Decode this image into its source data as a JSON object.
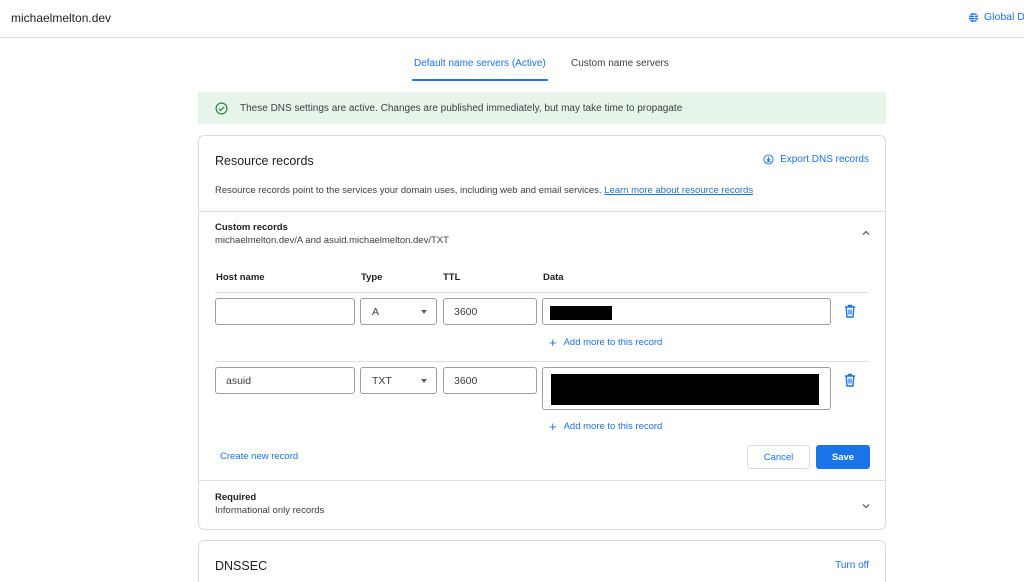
{
  "header": {
    "site_name": "michaelmelton.dev",
    "global_label": "Global D"
  },
  "tabs": [
    {
      "label": "Default name servers (Active)",
      "active": true
    },
    {
      "label": "Custom name servers",
      "active": false
    }
  ],
  "banner": {
    "text": "These DNS settings are active. Changes are published immediately, but may take time to propagate"
  },
  "resource_records": {
    "title": "Resource records",
    "export_label": "Export DNS records",
    "description": "Resource records point to the services your domain uses, including web and email services.",
    "learn_more": "Learn more about resource records",
    "custom": {
      "title": "Custom records",
      "subtitle": "michaelmelton.dev/A and asuid.michaelmelton.dev/TXT",
      "columns": {
        "host": "Host name",
        "type": "Type",
        "ttl": "TTL",
        "data": "Data"
      },
      "records": [
        {
          "host": "",
          "type": "A",
          "ttl": "3600"
        },
        {
          "host": "asuid",
          "type": "TXT",
          "ttl": "3600"
        }
      ],
      "add_more_label": "Add more to this record",
      "create_label": "Create new record",
      "cancel_label": "Cancel",
      "save_label": "Save"
    },
    "required": {
      "title": "Required",
      "subtitle": "Informational only records"
    }
  },
  "dnssec": {
    "title": "DNSSEC",
    "turn_off_label": "Turn off"
  },
  "colors": {
    "accent": "#1a73e8",
    "banner_bg": "#e6f4ea",
    "success": "#188038"
  }
}
